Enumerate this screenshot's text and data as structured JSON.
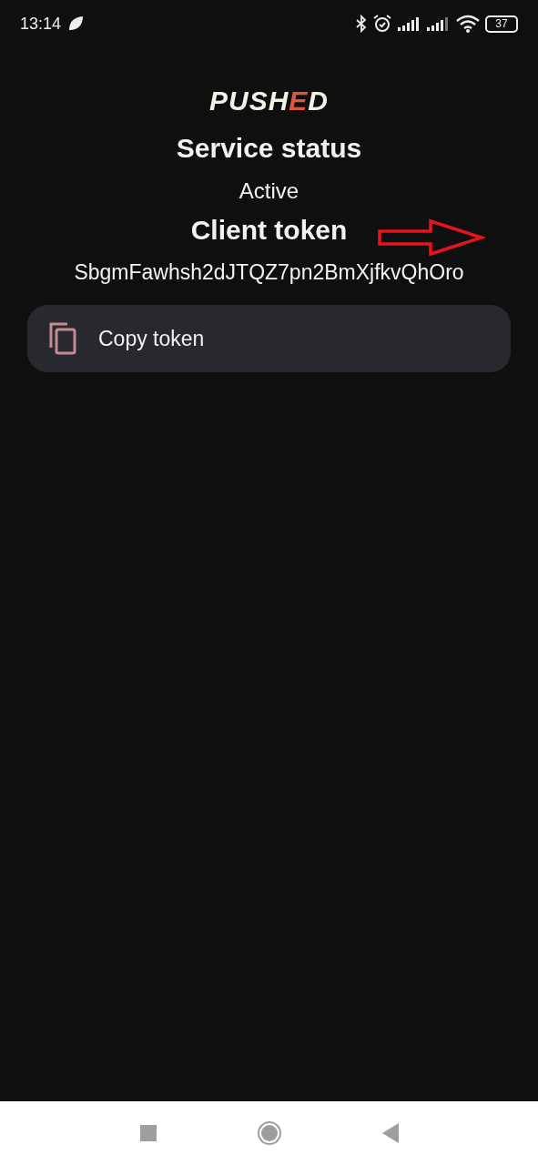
{
  "status_bar": {
    "time": "13:14",
    "battery": "37"
  },
  "logo": {
    "parts": [
      {
        "text": "PUSH",
        "accent": false
      },
      {
        "text": "E",
        "accent": true
      },
      {
        "text": "D",
        "accent": false
      }
    ]
  },
  "service_status": {
    "title": "Service status",
    "value": "Active"
  },
  "client_token": {
    "title": "Client token",
    "value": "SbgmFawhsh2dJTQZ7pn2BmXjfkvQhOro"
  },
  "copy_button": {
    "label": "Copy token"
  }
}
